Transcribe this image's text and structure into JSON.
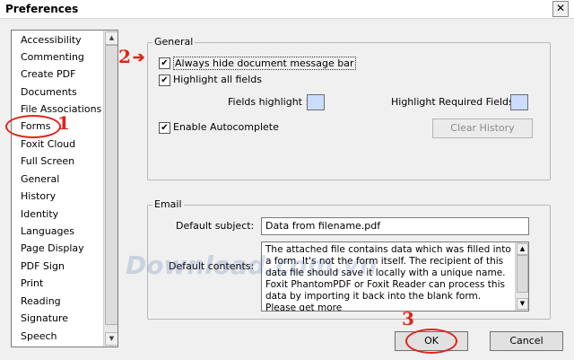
{
  "window": {
    "title": "Preferences",
    "close_label": "✕"
  },
  "categories": [
    "Accessibility",
    "Commenting",
    "Create PDF",
    "Documents",
    "File Associations",
    "Forms",
    "Foxit Cloud",
    "Full Screen",
    "General",
    "History",
    "Identity",
    "Languages",
    "Page Display",
    "PDF Sign",
    "Print",
    "Reading",
    "Signature",
    "Speech"
  ],
  "selected_category": "Forms",
  "general": {
    "title": "General",
    "always_hide": "Always hide document message bar",
    "highlight_all": "Highlight all fields",
    "fields_highlight": "Fields highlight :",
    "highlight_required": "Highlight Required Fields:",
    "enable_autocomplete": "Enable Autocomplete",
    "clear_history": "Clear History"
  },
  "email": {
    "title": "Email",
    "default_subject_label": "Default subject:",
    "default_subject_value": "Data from filename.pdf",
    "default_contents_label": "Default contents:",
    "default_contents_value": "The attached file contains data which was filled into a form. It's not the form itself. The recipient of this data file should save it locally with a unique name. Foxit PhantomPDF or Foxit Reader can process this data by importing it back into the blank form. Please get more"
  },
  "buttons": {
    "ok": "OK",
    "cancel": "Cancel"
  },
  "annotations": {
    "one": "1",
    "two": "2",
    "three": "3",
    "arrow": "➔"
  },
  "watermark": "Download.com.vn",
  "colors": {
    "swatch": "#ccdcff",
    "annotation": "#e0231a"
  }
}
